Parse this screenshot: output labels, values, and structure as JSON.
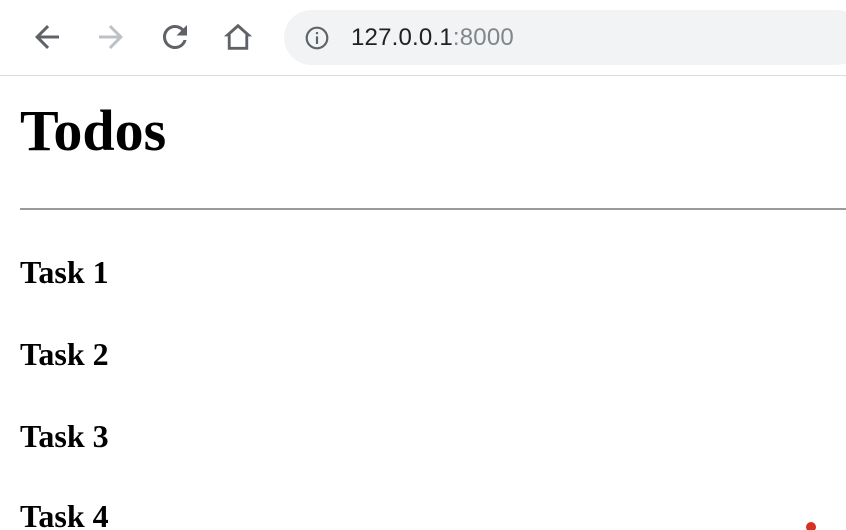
{
  "browser": {
    "address_bar": {
      "host": "127.0.0.1",
      "port": ":8000"
    },
    "icons": {
      "back": "arrow-left",
      "forward": "arrow-right",
      "reload": "reload",
      "home": "home",
      "site_info": "info-circle"
    }
  },
  "page": {
    "title": "Todos",
    "tasks": [
      {
        "label": "Task 1"
      },
      {
        "label": "Task 2"
      },
      {
        "label": "Task 3"
      },
      {
        "label": "Task 4"
      }
    ]
  },
  "colors": {
    "icon_active": "#5f6368",
    "icon_disabled": "#bdc1c6",
    "omnibox_bg": "#f1f3f4",
    "url_host": "#202124",
    "url_port": "#80868b",
    "divider": "#9a9a9a",
    "text": "#000000"
  }
}
